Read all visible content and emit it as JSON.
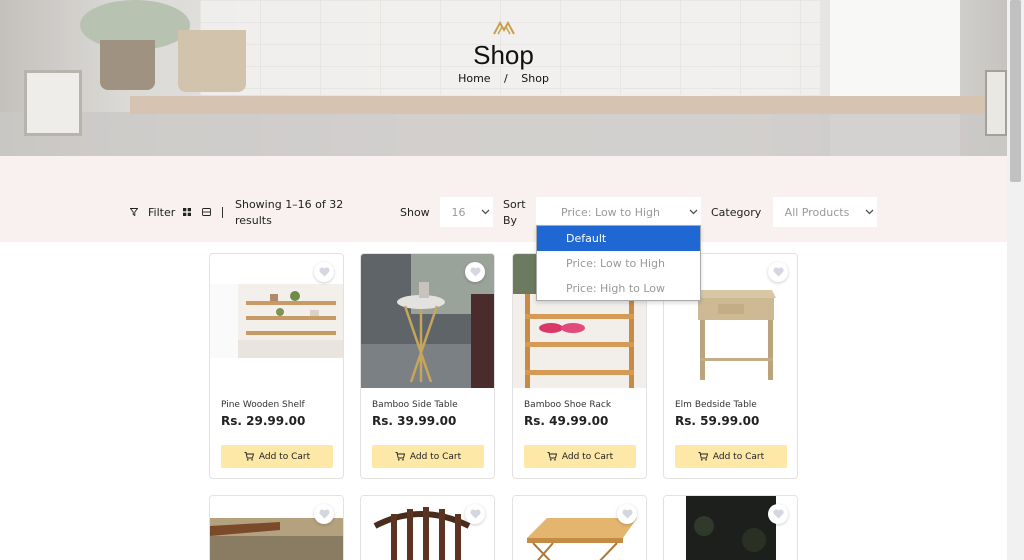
{
  "hero": {
    "title": "Shop",
    "breadcrumb": [
      "Home",
      "/",
      "Shop"
    ]
  },
  "toolbar": {
    "filter_label": "Filter",
    "result_text_line1": "Showing 1–16 of 32",
    "result_text_line2": "results",
    "show_label": "Show",
    "show_value": "16",
    "sort_label_line1": "Sort",
    "sort_label_line2": "By",
    "sort_value": "Price: Low to High",
    "sort_options": [
      "Default",
      "Price: Low to High",
      "Price: High to Low"
    ],
    "sort_highlighted": "Default",
    "category_label": "Category",
    "category_value": "All Products"
  },
  "products": [
    {
      "name": "Pine Wooden Shelf",
      "price": "Rs. 29.99.00",
      "cart": "Add to Cart"
    },
    {
      "name": "Bamboo Side Table",
      "price": "Rs. 39.99.00",
      "cart": "Add to Cart"
    },
    {
      "name": "Bamboo Shoe Rack",
      "price": "Rs. 49.99.00",
      "cart": "Add to Cart"
    },
    {
      "name": "Elm Bedside Table",
      "price": "Rs. 59.99.00",
      "cart": "Add to Cart"
    }
  ],
  "colors": {
    "accent": "#1f67d2",
    "cart_button": "#fde8a8",
    "band": "#f9f1ef",
    "logo": "#c9a04a"
  },
  "icons": [
    "logo-icon",
    "filter-icon",
    "grid-view-icon",
    "list-view-icon",
    "chevron-down-icon",
    "heart-icon",
    "cart-icon"
  ]
}
